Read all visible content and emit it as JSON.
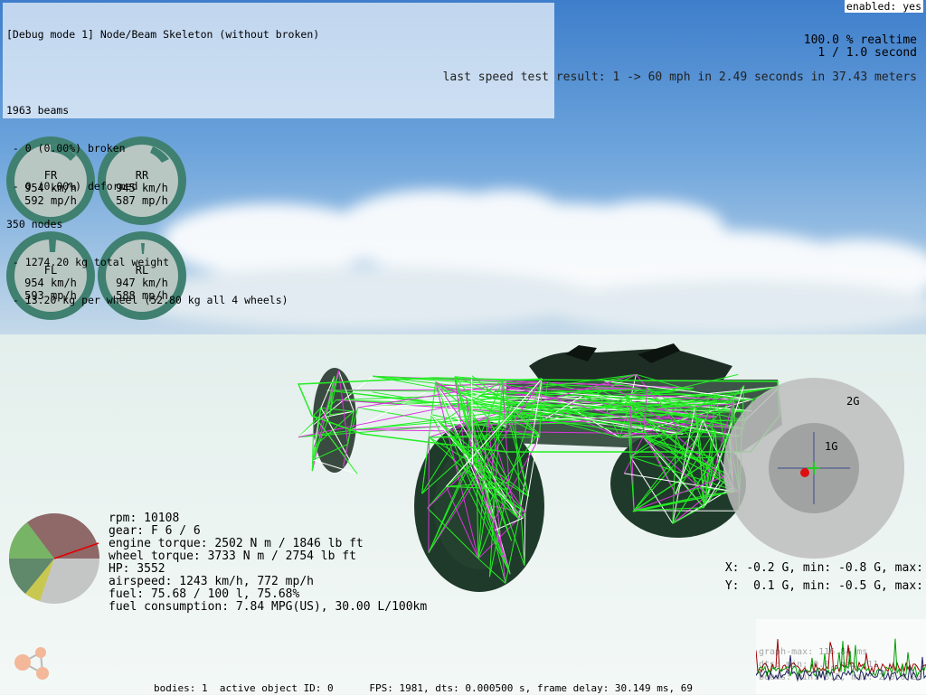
{
  "debug": {
    "title": "[Debug mode 1] Node/Beam Skeleton (without broken)",
    "lines": [
      "",
      "1963 beams",
      " - 0 (0.00%) broken",
      " - 0 (0.00%) deformed",
      "350 nodes",
      " - 1274.20 kg total weight",
      " - 13.20 kg per wheel (52.80 kg all 4 wheels)"
    ]
  },
  "enabled": "enabled: yes",
  "realtime": {
    "percent": "100.0 % realtime",
    "ratio": "1 / 1.0 second"
  },
  "speed_test": "last speed test result: 1 -> 60 mph in 2.49 seconds in 37.43 meters",
  "wheels": [
    {
      "name": "FR",
      "kmh": "954 km/h",
      "mph": "592 mp/h"
    },
    {
      "name": "RR",
      "kmh": "945 km/h",
      "mph": "587 mp/h"
    },
    {
      "name": "FL",
      "kmh": "954 km/h",
      "mph": "593 mp/h"
    },
    {
      "name": "RL",
      "kmh": "947 km/h",
      "mph": "588 mp/h"
    }
  ],
  "stats": {
    "rpm": "rpm: 10108",
    "gear": "gear: F 6 / 6",
    "engine_torque": "engine torque: 2502 N m / 1846 lb ft",
    "wheel_torque": "wheel torque: 3733 N m / 2754 lb ft",
    "hp": "HP: 3552",
    "airspeed": "airspeed: 1243 km/h, 772 mp/h",
    "fuel": "fuel: 75.68 / 100 l, 75.68%",
    "fuel_consumption": "fuel consumption: 7.84 MPG(US), 30.00 L/100km"
  },
  "gforce": {
    "label_2g": "2G",
    "label_1g": "1G",
    "x_line": "X: -0.2 G, min: -0.8 G, max:",
    "y_line": "Y:  0.1 G, min: -0.5 G, max:"
  },
  "graph": {
    "line1": "graph-max: 116.84 ms",
    "line2": "dts: min: 0.0, max: 11",
    "line3": "beams: min: 3.2, max: 2 0.0 20"
  },
  "bottom_bar": "bodies: 1  active object ID: 0      FPS: 1981, dts: 0.000500 s, frame delay: 30.149 ms, 69",
  "colors": {
    "skeleton_green": "#22ee22",
    "skeleton_magenta": "#dd33dd",
    "gauge_ring": "#3f8070",
    "gauge_face": "#b9c7c3"
  }
}
